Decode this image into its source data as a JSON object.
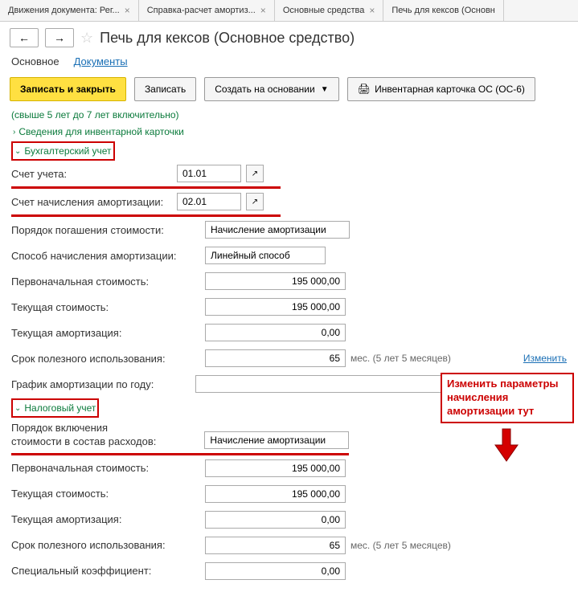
{
  "tabs": [
    {
      "label": "Движения документа: Рег..."
    },
    {
      "label": "Справка-расчет амортиз..."
    },
    {
      "label": "Основные средства"
    },
    {
      "label": "Печь для кексов (Основн"
    }
  ],
  "title": "Печь для кексов (Основное средство)",
  "subtabs": {
    "main": "Основное",
    "docs": "Документы"
  },
  "actions": {
    "write_close": "Записать и закрыть",
    "write": "Записать",
    "create": "Создать на основании",
    "inventory_card": "Инвентарная карточка ОС (ОС-6)"
  },
  "content": {
    "cut_line": "(свыше 5 лет до 7 лет включительно)",
    "inventory_link": "Сведения для инвентарной карточки",
    "accounting_section": "Бухгалтерский учет",
    "account_label": "Счет учета:",
    "account_value": "01.01",
    "depr_account_label": "Счет начисления амортизации:",
    "depr_account_value": "02.01",
    "repay_label": "Порядок погашения стоимости:",
    "repay_value": "Начисление амортизации",
    "method_label": "Способ начисления амортизации:",
    "method_value": "Линейный способ",
    "initial_cost_label": "Первоначальная стоимость:",
    "initial_cost_value": "195 000,00",
    "current_cost_label": "Текущая стоимость:",
    "current_cost_value": "195 000,00",
    "current_depr_label": "Текущая амортизация:",
    "current_depr_value": "0,00",
    "useful_life_label": "Срок полезного использования:",
    "useful_life_value": "65",
    "useful_life_hint": "мес. (5 лет 5 месяцев)",
    "change_link": "Изменить",
    "schedule_label": "График амортизации по году:",
    "schedule_value": "",
    "tax_section": "Налоговый учет",
    "tax_include_label1": "Порядок включения",
    "tax_include_label2": "стоимости в состав расходов:",
    "tax_include_value": "Начисление амортизации",
    "tax_initial_cost_label": "Первоначальная стоимость:",
    "tax_initial_cost_value": "195 000,00",
    "tax_current_cost_label": "Текущая стоимость:",
    "tax_current_cost_value": "195 000,00",
    "tax_current_depr_label": "Текущая амортизация:",
    "tax_current_depr_value": "0,00",
    "tax_useful_life_label": "Срок полезного использования:",
    "tax_useful_life_value": "65",
    "tax_useful_life_hint": "мес. (5 лет 5 месяцев)",
    "special_coef_label": "Специальный коэффициент:",
    "special_coef_value": "0,00"
  },
  "annotation": "Изменить параметры начисления амортизации тут"
}
